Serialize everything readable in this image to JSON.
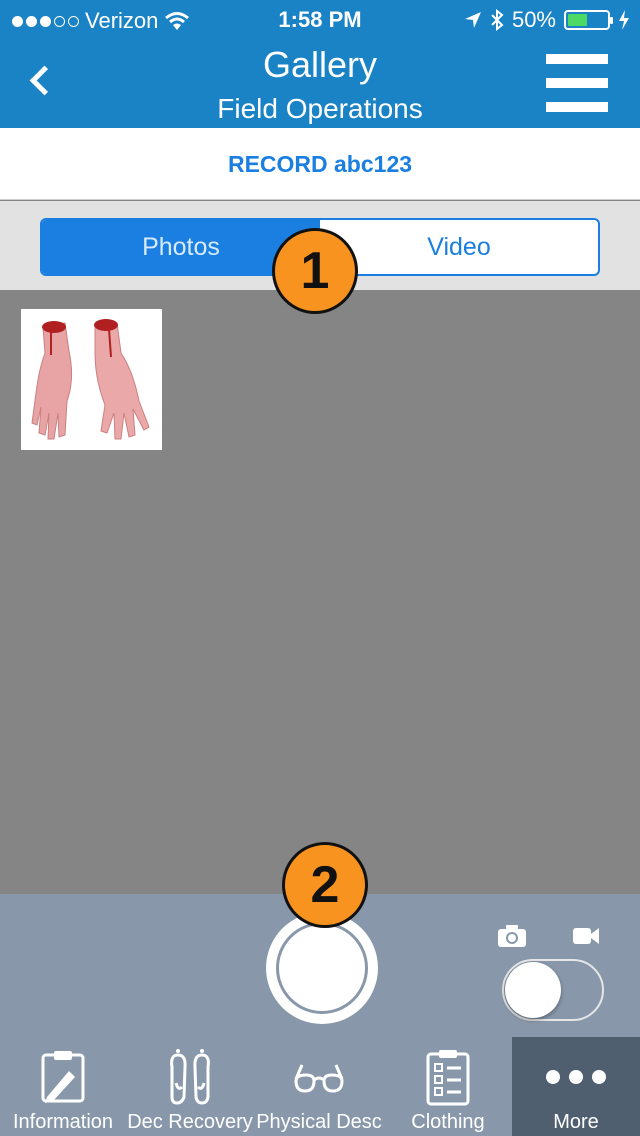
{
  "status_bar": {
    "carrier": "Verizon",
    "time": "1:58 PM",
    "battery": "50%",
    "battery_level": 0.5,
    "signal_bars": 3,
    "signal_total": 5
  },
  "nav": {
    "title": "Gallery",
    "subtitle": "Field Operations"
  },
  "record": {
    "label": "RECORD abc123"
  },
  "segments": {
    "photos": "Photos",
    "video": "Video",
    "selected": "Photos"
  },
  "badges": {
    "one": "1",
    "two": "2"
  },
  "gallery": {
    "items": [
      {
        "type": "photo"
      }
    ]
  },
  "camera": {
    "mode": "photo"
  },
  "tabs": [
    {
      "label": "Information",
      "icon": "clipboard-pencil-icon"
    },
    {
      "label": "Dec Recovery",
      "icon": "footprints-icon"
    },
    {
      "label": "Physical Desc",
      "icon": "glasses-icon"
    },
    {
      "label": "Clothing",
      "icon": "checklist-icon"
    },
    {
      "label": "More",
      "icon": "more-dots-icon",
      "active": true
    }
  ],
  "colors": {
    "header": "#1a83c6",
    "accent": "#1a7fe0",
    "badge": "#f7931e",
    "tab_active": "#4f5f70",
    "battery": "#4cd964"
  }
}
